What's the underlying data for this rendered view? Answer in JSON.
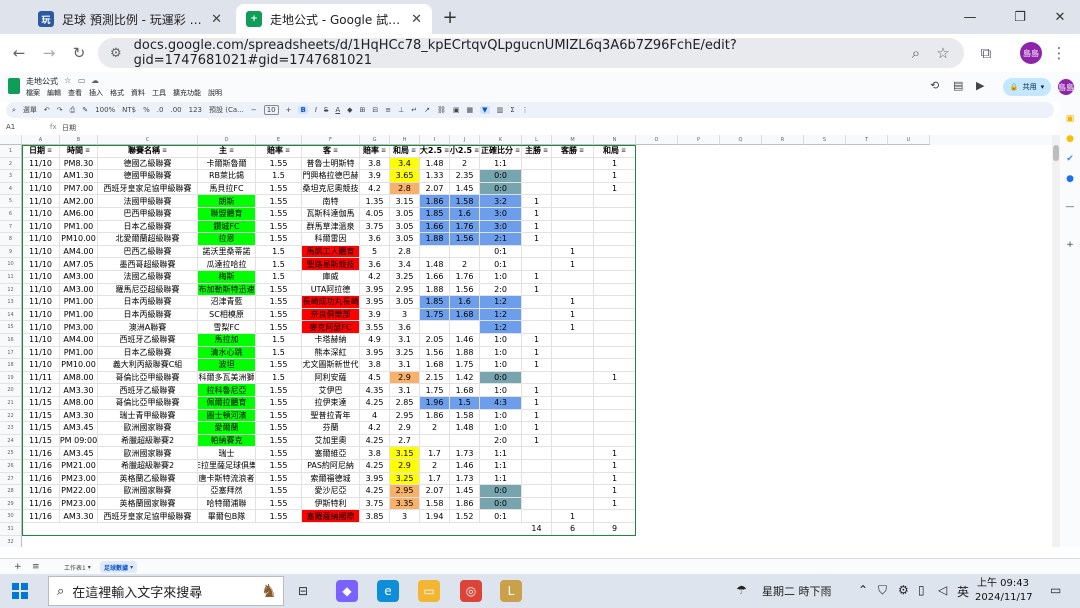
{
  "browser": {
    "tabs": [
      {
        "favicon": "玩",
        "label": "足球 預測比例 - 玩運彩 台灣運彩"
      },
      {
        "favicon": "+",
        "label": "走地公式 - Google 試算表"
      }
    ],
    "new_tab": "+",
    "url": "docs.google.com/spreadsheets/d/1HqHCc78_kpECrtqvQLpgucnUMIZL6q3A6b7Z96FchE/edit?gid=1747681021#gid=1747681021",
    "profile_initials": "島島"
  },
  "sheets": {
    "title": "走地公式",
    "menu": [
      "檔案",
      "編輯",
      "查看",
      "插入",
      "格式",
      "資料",
      "工具",
      "擴充功能",
      "說明"
    ],
    "share_label": "共用",
    "toolbar": {
      "search": "選單",
      "zoom": "100%",
      "currency": "NT$",
      "percent": "%",
      "dec1": ".0",
      "dec2": ".00",
      "num": "123",
      "font": "預設 (Ca...",
      "font_size": "10",
      "bold": "B",
      "italic": "I",
      "strike": "S",
      "text_color": "A"
    },
    "name_box": "A1",
    "formula": "日期",
    "columns": [
      "A",
      "B",
      "C",
      "D",
      "E",
      "F",
      "G",
      "H",
      "I",
      "J",
      "K",
      "L",
      "M",
      "N",
      "O",
      "P",
      "Q",
      "R",
      "S",
      "T",
      "U"
    ],
    "row_numbers": [
      "1",
      "2",
      "3",
      "4",
      "5",
      "6",
      "7",
      "8",
      "9",
      "10",
      "11",
      "12",
      "13",
      "14",
      "15",
      "16",
      "17",
      "18",
      "19",
      "20",
      "21",
      "22",
      "23",
      "24",
      "25",
      "26",
      "27",
      "28",
      "29",
      "30",
      "31",
      "32"
    ],
    "headers": [
      "日期",
      "時間",
      "聯賽名稱",
      "主",
      "賠率",
      "客",
      "賠率",
      "和局",
      "大2.5",
      "小2.5",
      "正確比分",
      "主勝",
      "客勝",
      "和局"
    ],
    "rows": [
      [
        "11/10",
        "PM8.30",
        "德國乙級聯賽",
        "卡爾斯魯爾",
        "1.55",
        "普魯士明斯特",
        "3.8",
        "3.4",
        "1.48",
        "2",
        "1:1",
        "",
        "",
        "1"
      ],
      [
        "11/10",
        "AM1.30",
        "德國甲級聯賽",
        "RB萊比錫",
        "1.5",
        "門興格拉德巴赫",
        "3.9",
        "3.65",
        "1.33",
        "2.35",
        "0:0",
        "",
        "",
        "1"
      ],
      [
        "11/10",
        "PM7.00",
        "西班牙皇家足協甲級聯賽",
        "馬貝拉FC",
        "1.55",
        "桑坦克尼奧競技",
        "4.2",
        "2.8",
        "2.07",
        "1.45",
        "0:0",
        "",
        "",
        "1"
      ],
      [
        "11/10",
        "AM2.00",
        "法國甲級聯賽",
        "朗斯",
        "1.55",
        "南特",
        "1.35",
        "3.15",
        "1.86",
        "1.58",
        "3:2",
        "1",
        "",
        ""
      ],
      [
        "11/10",
        "AM6.00",
        "巴西甲級聯賽",
        "聯盟體育",
        "1.55",
        "瓦斯科達伽馬",
        "4.05",
        "3.05",
        "1.85",
        "1.6",
        "3:0",
        "1",
        "",
        ""
      ],
      [
        "11/10",
        "PM1.00",
        "日本乙級聯賽",
        "鑽城FC",
        "1.55",
        "群馬草津溫泉",
        "3.75",
        "3.05",
        "1.66",
        "1.76",
        "3:0",
        "1",
        "",
        ""
      ],
      [
        "11/10",
        "PM10.00",
        "北愛爾蘭超級聯賽",
        "拉恩",
        "1.55",
        "科爾雷因",
        "3.6",
        "3.05",
        "1.88",
        "1.56",
        "2:1",
        "1",
        "",
        ""
      ],
      [
        "11/10",
        "AM4.00",
        "巴西乙級聯賽",
        "諾沃里桑蒂諾",
        "1.5",
        "馬凱工人體育",
        "5",
        "2.8",
        "",
        "",
        "0:1",
        "",
        "1",
        ""
      ],
      [
        "11/10",
        "AM7.05",
        "墨西哥超級聯賽",
        "瓜達拉哈拉",
        "1.5",
        "聖路易斯競技",
        "3.6",
        "3.4",
        "1.48",
        "2",
        "0:1",
        "",
        "1",
        ""
      ],
      [
        "11/10",
        "AM3.00",
        "法國乙級聯賽",
        "梅斯",
        "1.5",
        "庫威",
        "4.2",
        "3.25",
        "1.66",
        "1.76",
        "1:0",
        "1",
        "",
        ""
      ],
      [
        "11/10",
        "AM3.00",
        "羅馬尼亞超級聯賽",
        "布加勒斯特迅速",
        "1.55",
        "UTA阿拉德",
        "3.95",
        "2.95",
        "1.88",
        "1.56",
        "2:0",
        "1",
        "",
        ""
      ],
      [
        "11/10",
        "PM1.00",
        "日本丙級聯賽",
        "沼津青藍",
        "1.55",
        "長崎成功丸長崎",
        "3.95",
        "3.05",
        "1.85",
        "1.6",
        "1:2",
        "",
        "1",
        ""
      ],
      [
        "11/10",
        "PM1.00",
        "日本丙級聯賽",
        "SC相模原",
        "1.55",
        "奈良俱樂部",
        "3.9",
        "3",
        "1.75",
        "1.68",
        "1:2",
        "",
        "1",
        ""
      ],
      [
        "11/10",
        "PM3.00",
        "澳洲A聯賽",
        "雪梨FC",
        "1.55",
        "麥克阿瑟FC",
        "3.55",
        "3.6",
        "",
        "",
        "1:2",
        "",
        "1",
        ""
      ],
      [
        "11/10",
        "AM4.00",
        "西班牙乙級聯賽",
        "馬拉加",
        "1.5",
        "卡塔赫納",
        "4.9",
        "3.1",
        "2.05",
        "1.46",
        "1:0",
        "1",
        "",
        ""
      ],
      [
        "11/10",
        "PM1.00",
        "日本乙級聯賽",
        "清水心跳",
        "1.5",
        "熊本深紅",
        "3.95",
        "3.25",
        "1.56",
        "1.88",
        "1:0",
        "1",
        "",
        ""
      ],
      [
        "11/10",
        "PM10.00",
        "義大利丙級聯賽C組",
        "波坦",
        "1.55",
        "尤文圖斯新世代",
        "3.8",
        "3.1",
        "1.68",
        "1.75",
        "1:0",
        "1",
        "",
        ""
      ],
      [
        "11/11",
        "AM8.00",
        "哥倫比亞甲級聯賽",
        "科爾多瓦美洲獅",
        "1.5",
        "阿利安薩",
        "4.5",
        "2.9",
        "2.15",
        "1.42",
        "0:0",
        "",
        "",
        "1"
      ],
      [
        "11/12",
        "AM3.30",
        "西班牙乙級聯賽",
        "拉科魯尼亞",
        "1.55",
        "艾伊巴",
        "4.35",
        "3.1",
        "1.75",
        "1.68",
        "1:0",
        "1",
        "",
        ""
      ],
      [
        "11/15",
        "AM8.00",
        "哥倫比亞甲級聯賽",
        "佩爾拉體育",
        "1.55",
        "拉伊束達",
        "4.25",
        "2.85",
        "1.96",
        "1.5",
        "4:3",
        "1",
        "",
        ""
      ],
      [
        "11/15",
        "AM3.30",
        "瑞士青甲級聯賽",
        "圖士頓河濱",
        "1.55",
        "聖普拉青年",
        "4",
        "2.95",
        "1.86",
        "1.58",
        "1:0",
        "1",
        "",
        ""
      ],
      [
        "11/15",
        "AM3.45",
        "歐洲國家聯賽",
        "愛爾蘭",
        "1.55",
        "芬蘭",
        "4.2",
        "2.9",
        "2",
        "1.48",
        "1:0",
        "1",
        "",
        ""
      ],
      [
        "11/15",
        "PM 09:00",
        "希臘超級聯賽2",
        "帕納賽克",
        "1.55",
        "艾加里奧",
        "4.25",
        "2.7",
        "",
        "",
        "2:0",
        "1",
        "",
        ""
      ],
      [
        "11/16",
        "AM3.45",
        "歐洲國家聯賽",
        "瑞士",
        "1.55",
        "塞爾維亞",
        "3.8",
        "3.15",
        "1.7",
        "1.73",
        "1:1",
        "",
        "",
        "1"
      ],
      [
        "11/16",
        "PM21.00",
        "希臘超級聯賽2",
        "E拉里薩足球俱樂",
        "1.55",
        "PAS約阿尼納",
        "4.25",
        "2.9",
        "2",
        "1.46",
        "1:1",
        "",
        "",
        "1"
      ],
      [
        "11/16",
        "PM23.00",
        "英格蘭乙級聯賽",
        "唐卡斯特流浪者",
        "1.55",
        "索爾福德城",
        "3.95",
        "3.25",
        "1.7",
        "1.73",
        "1:1",
        "",
        "",
        "1"
      ],
      [
        "11/16",
        "PM22.00",
        "歐洲國家聯賽",
        "亞塞拜然",
        "1.55",
        "愛沙尼亞",
        "4.25",
        "2.95",
        "2.07",
        "1.45",
        "0:0",
        "",
        "",
        "1"
      ],
      [
        "11/16",
        "PM23.00",
        "英格蘭國家聯賽",
        "哈特爾浦聯",
        "1.55",
        "伊斯特利",
        "3.75",
        "3.35",
        "1.58",
        "1.86",
        "0:0",
        "",
        "",
        "1"
      ],
      [
        "11/16",
        "AM3.30",
        "西班牙皇家足協甲級聯賽",
        "畢爾包B隊",
        "1.55",
        "塞羅薩納國際",
        "3.85",
        "3",
        "1.94",
        "1.52",
        "0:1",
        "",
        "1",
        ""
      ]
    ],
    "totals": {
      "home": "14",
      "away": "6",
      "draw": "9"
    },
    "highlights": {
      "green_home": [
        3,
        4,
        5,
        6,
        9,
        10,
        14,
        15,
        16,
        18,
        19,
        20,
        21,
        22
      ],
      "red_away": [
        7,
        8,
        11,
        12,
        13,
        28
      ],
      "yellow_draw": [
        0,
        1,
        2,
        17,
        23,
        24,
        25,
        26,
        27
      ],
      "blue_ou": [
        3,
        4,
        5,
        6,
        11,
        12,
        19
      ],
      "teal_score": [
        1,
        2,
        17,
        26,
        27
      ],
      "blue_score": [
        3,
        4,
        5,
        6,
        11,
        12,
        13,
        19
      ]
    },
    "sheet_tabs": [
      "工作表1",
      "足球數據"
    ],
    "colors": {
      "green": "#00ff00",
      "red": "#ff0000",
      "yellow": "#ffff00",
      "orange": "#f6b26b",
      "blue": "#6d9eeb",
      "teal": "#76a5af",
      "table_border": "#1a8a3c"
    }
  },
  "taskbar": {
    "search_placeholder": "在這裡輸入文字來搜尋",
    "weather": "星期二 時下雨",
    "ime": "英",
    "time": "上午 09:43",
    "date": "2024/11/17"
  }
}
